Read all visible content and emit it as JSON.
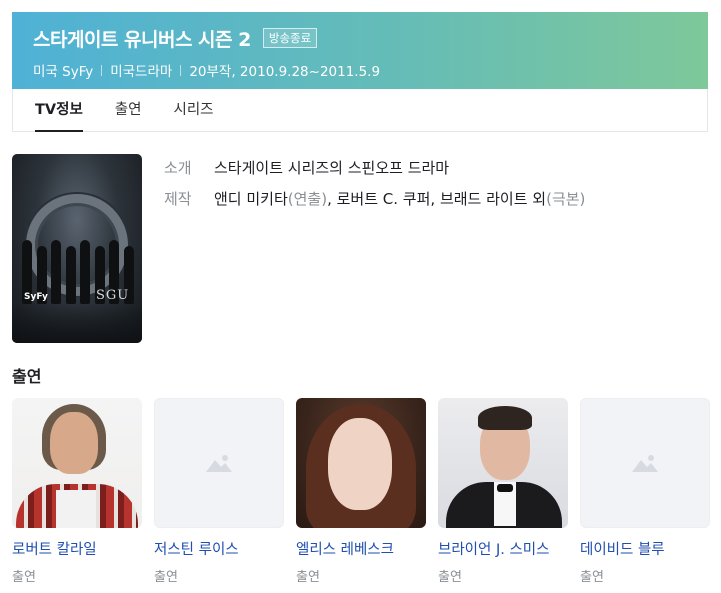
{
  "header": {
    "title": "스타게이트 유니버스 시즌 2",
    "badge": "방송종료",
    "meta": [
      "미국 SyFy",
      "미국드라마",
      "20부작, 2010.9.28~2011.5.9"
    ]
  },
  "tabs": [
    {
      "label": "TV정보",
      "active": true
    },
    {
      "label": "출연",
      "active": false
    },
    {
      "label": "시리즈",
      "active": false
    }
  ],
  "poster": {
    "logo_text": "SyFy",
    "title_text": "SGU"
  },
  "info": {
    "intro_label": "소개",
    "intro_value": "스타게이트 시리즈의 스핀오프 드라마",
    "staff_label": "제작",
    "staff_director": "앤디 미키타",
    "staff_director_role": "(연출)",
    "staff_writers": ", 로버트 C. 쿠퍼, 브래드 라이트 외",
    "staff_writers_role": "(극본)"
  },
  "cast_section": {
    "heading": "출연",
    "members": [
      {
        "name": "로버트 칼라일",
        "role": "출연",
        "photo": "portrait"
      },
      {
        "name": "저스틴 루이스",
        "role": "출연",
        "photo": "placeholder"
      },
      {
        "name": "엘리스 레베스크",
        "role": "출연",
        "photo": "portrait"
      },
      {
        "name": "브라이언 J. 스미스",
        "role": "출연",
        "photo": "portrait"
      },
      {
        "name": "데이비드 블루",
        "role": "출연",
        "photo": "placeholder"
      }
    ]
  },
  "colors": {
    "header_gradient_start": "#4fb1d6",
    "header_gradient_end": "#7ec89a",
    "link": "#1f4fb0",
    "muted": "#8a8f94"
  }
}
